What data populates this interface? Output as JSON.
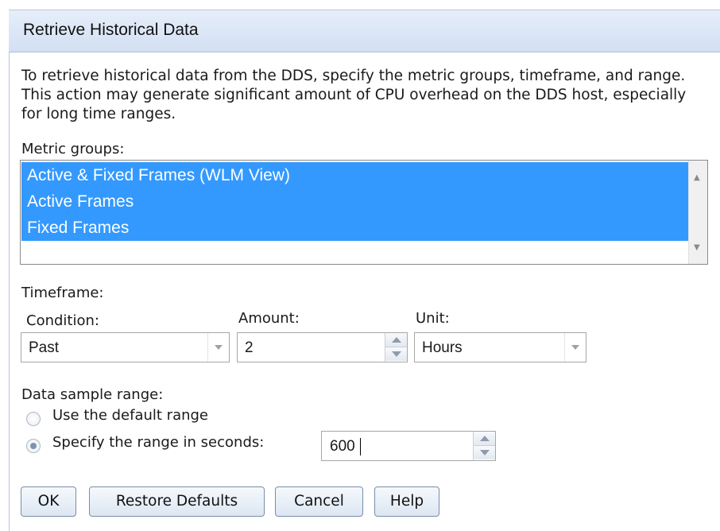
{
  "dialog": {
    "title": "Retrieve Historical Data",
    "description": "To retrieve historical data from the DDS, specify the metric groups, timeframe, and range. This action may generate significant amount of CPU overhead on the DDS host, especially for long time ranges."
  },
  "metric_groups": {
    "label": "Metric groups:",
    "items": [
      {
        "label": "Active & Fixed Frames (WLM View)",
        "selected": true
      },
      {
        "label": "Active Frames",
        "selected": true
      },
      {
        "label": "Fixed Frames",
        "selected": true
      }
    ]
  },
  "timeframe": {
    "label": "Timeframe:",
    "condition_label": "Condition:",
    "condition_value": "Past",
    "amount_label": "Amount:",
    "amount_value": "2",
    "unit_label": "Unit:",
    "unit_value": "Hours"
  },
  "sample_range": {
    "label": "Data sample range:",
    "option_default": "Use the default range",
    "option_specify": "Specify the range in seconds:",
    "selected_option": "specify",
    "seconds_value": "600"
  },
  "buttons": {
    "ok": "OK",
    "restore": "Restore Defaults",
    "cancel": "Cancel",
    "help": "Help"
  },
  "colors": {
    "selection": "#3399ff",
    "title_bar": "#d9e5f5"
  },
  "icons": {
    "dropdown": "chevron-down-icon",
    "spinner_up": "spinner-up-icon",
    "spinner_down": "spinner-down-icon"
  }
}
